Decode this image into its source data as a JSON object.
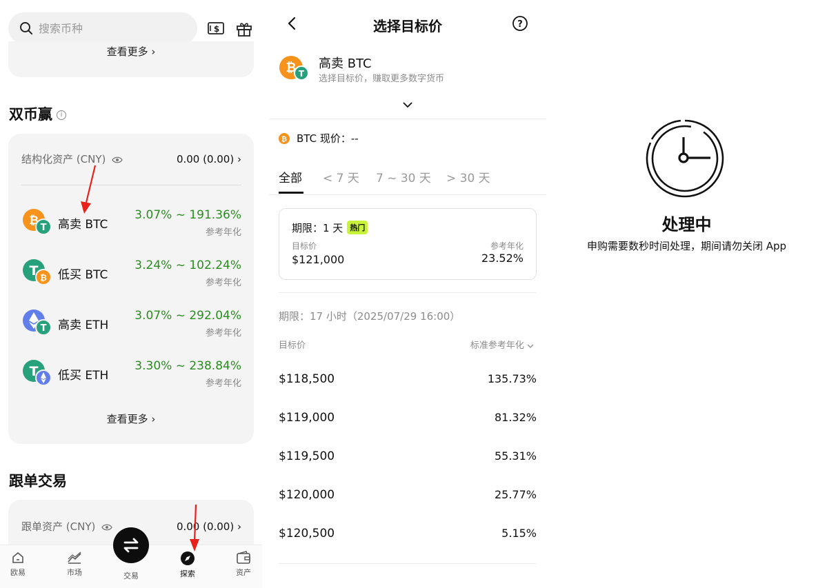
{
  "left_panel": {
    "search_placeholder": "搜索币种",
    "prev_card_more": "查看更多",
    "dual_section_title": "双币赢",
    "dual_asset_label": "结构化资产 (CNY)",
    "dual_asset_value": "0.00 (0.00)",
    "products": [
      {
        "name": "高卖 BTC",
        "rate": "3.07% ~ 191.36%",
        "sub": "参考年化"
      },
      {
        "name": "低买 BTC",
        "rate": "3.24% ~ 102.24%",
        "sub": "参考年化"
      },
      {
        "name": "高卖 ETH",
        "rate": "3.07% ~ 292.04%",
        "sub": "参考年化"
      },
      {
        "name": "低买 ETH",
        "rate": "3.30% ~ 238.84%",
        "sub": "参考年化"
      }
    ],
    "dual_more": "查看更多",
    "copy_section_title": "跟单交易",
    "copy_asset_label": "跟单资产 (CNY)",
    "copy_asset_value": "0.00 (0.00)",
    "tabs": [
      "欧易",
      "市场",
      "交易",
      "探索",
      "资产"
    ],
    "colors": {
      "rate_green": "#2a8b20",
      "btc_orange": "#f7931a",
      "usdt_green": "#26a17b",
      "eth_blue": "#627eea",
      "arrow_red": "#e8221b"
    }
  },
  "middle_panel": {
    "title": "选择目标价",
    "product_name": "高卖 BTC",
    "product_desc": "选择目标价，赚取更多数字货币",
    "current_price": "BTC 现价：--",
    "filter_tabs": [
      "全部",
      "< 7 天",
      "7 ~ 30 天",
      "> 30 天"
    ],
    "hot": {
      "term": "期限：1 天",
      "badge": "热门",
      "target_label": "目标价",
      "target_value": "$121,000",
      "apy_label": "参考年化",
      "apy_value": "23.52%"
    },
    "period": "期限：17 小时（2025/07/29 16:00）",
    "col_left": "目标价",
    "col_right": "标准参考年化",
    "rows": [
      {
        "price": "$118,500",
        "apy": "135.73%"
      },
      {
        "price": "$119,000",
        "apy": "81.32%"
      },
      {
        "price": "$119,500",
        "apy": "55.31%"
      },
      {
        "price": "$120,000",
        "apy": "25.77%"
      },
      {
        "price": "$120,500",
        "apy": "5.15%"
      }
    ]
  },
  "right_panel": {
    "status_title": "处理中",
    "status_message": "申购需要数秒时间处理，期间请勿关闭 App"
  }
}
